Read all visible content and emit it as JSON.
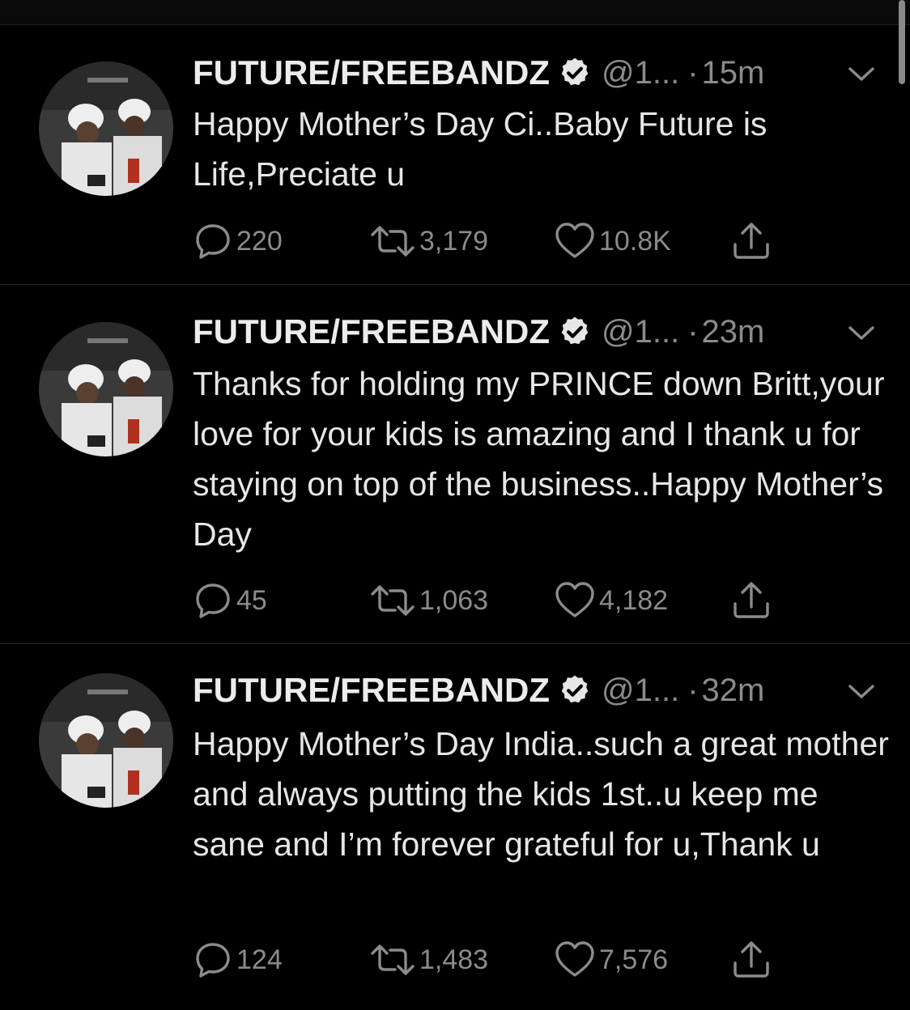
{
  "colors": {
    "background": "#000000",
    "text": "#e6e6e6",
    "muted": "#8b8b8b",
    "divider": "#2b2b2b"
  },
  "tweets": [
    {
      "name": "FUTURE/FREEBANDZ",
      "handle": "@1...",
      "dot": "·",
      "time": "15m",
      "text": "Happy Mother’s Day Ci..Baby Future is Life,Preciate u",
      "replies": "220",
      "retweets": "3,179",
      "likes": "10.8K"
    },
    {
      "name": "FUTURE/FREEBANDZ",
      "handle": "@1...",
      "dot": "·",
      "time": "23m",
      "text": "Thanks for holding my PRINCE down Britt,your love for your kids is amazing and I thank u for staying on top of the business..Happy Mother’s Day",
      "replies": "45",
      "retweets": "1,063",
      "likes": "4,182"
    },
    {
      "name": "FUTURE/FREEBANDZ",
      "handle": "@1...",
      "dot": "·",
      "time": "32m",
      "text": "Happy Mother’s Day India..such a great mother and always putting the kids 1st..u keep me sane and I’m forever grateful for u,Thank u",
      "replies": "124",
      "retweets": "1,483",
      "likes": "7,576"
    }
  ],
  "icons": {
    "reply": "reply-icon",
    "retweet": "retweet-icon",
    "like": "heart-icon",
    "share": "share-icon",
    "verified": "verified-badge-icon",
    "caret": "chevron-down-icon"
  }
}
